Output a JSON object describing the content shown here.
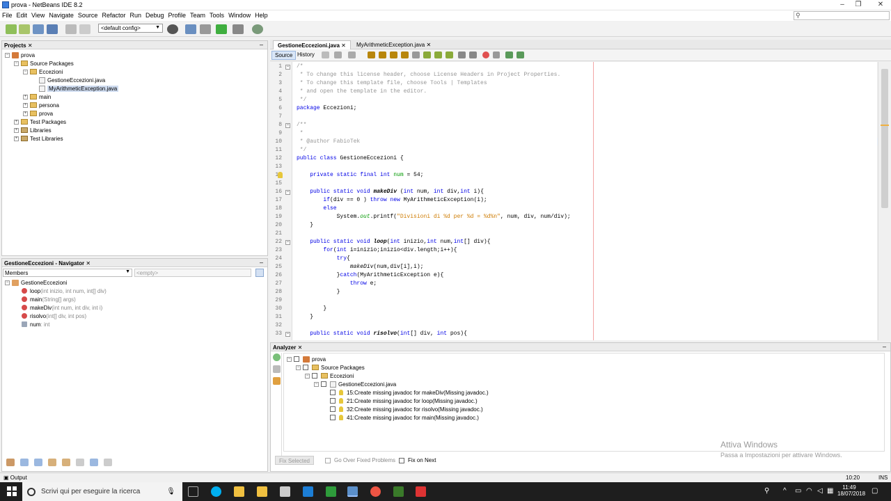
{
  "window": {
    "title": "prova - NetBeans IDE 8.2"
  },
  "menu": [
    "File",
    "Edit",
    "View",
    "Navigate",
    "Source",
    "Refactor",
    "Run",
    "Debug",
    "Profile",
    "Team",
    "Tools",
    "Window",
    "Help"
  ],
  "toolbar": {
    "config": "<default config>"
  },
  "projects": {
    "tab": "Projects",
    "tree": [
      {
        "label": "prova",
        "indent": 0,
        "icon": "project"
      },
      {
        "label": "Source Packages",
        "indent": 1,
        "icon": "folder"
      },
      {
        "label": "Eccezioni",
        "indent": 2,
        "icon": "folder"
      },
      {
        "label": "GestioneEccezioni.java",
        "indent": 3,
        "icon": "java"
      },
      {
        "label": "MyArithmeticException.java",
        "indent": 3,
        "icon": "java",
        "selected": true
      },
      {
        "label": "main",
        "indent": 2,
        "icon": "folder"
      },
      {
        "label": "persona",
        "indent": 2,
        "icon": "folder"
      },
      {
        "label": "prova",
        "indent": 2,
        "icon": "folder"
      },
      {
        "label": "Test Packages",
        "indent": 1,
        "icon": "folder"
      },
      {
        "label": "Libraries",
        "indent": 1,
        "icon": "lib"
      },
      {
        "label": "Test Libraries",
        "indent": 1,
        "icon": "lib"
      }
    ]
  },
  "navigator": {
    "tab": "GestioneEccezioni - Navigator",
    "filter": "Members",
    "empty": "<empty>",
    "root": "GestioneEccezioni",
    "members": [
      {
        "name": "loop",
        "params": "(int inizio, int num, int[] div)"
      },
      {
        "name": "main",
        "params": "(String[] args)"
      },
      {
        "name": "makeDiv",
        "params": "(int num, int div, int i)"
      },
      {
        "name": "risolvo",
        "params": "(int[] div, int pos)"
      },
      {
        "name": "num",
        "params": " : int"
      }
    ]
  },
  "editor": {
    "tabs": [
      "GestioneEccezioni.java",
      "MyArithmeticException.java"
    ],
    "modes": [
      "Source",
      "History"
    ],
    "lines": [
      {
        "n": "1",
        "html": "<span class='cm'>/*</span>"
      },
      {
        "n": "2",
        "html": "<span class='cm'> * To change this license header, choose License Headers in Project Properties.</span>"
      },
      {
        "n": "3",
        "html": "<span class='cm'> * To change this template file, choose Tools | Templates</span>"
      },
      {
        "n": "4",
        "html": "<span class='cm'> * and open the template in the editor.</span>"
      },
      {
        "n": "5",
        "html": "<span class='cm'> */</span>"
      },
      {
        "n": "6",
        "html": "<span class='kw'>package</span> Eccezioni;"
      },
      {
        "n": "7",
        "html": ""
      },
      {
        "n": "8",
        "html": "<span class='cm'>/**</span>"
      },
      {
        "n": "9",
        "html": "<span class='cm'> *</span>"
      },
      {
        "n": "10",
        "html": "<span class='cm'> * @author FabioTek</span>"
      },
      {
        "n": "11",
        "html": "<span class='cm'> */</span>"
      },
      {
        "n": "12",
        "html": "<span class='kw'>public class</span> GestioneEccezioni {"
      },
      {
        "n": "13",
        "html": ""
      },
      {
        "n": "14",
        "html": "    <span class='kw'>private static final int</span> <span style='color:#009900'>num</span> = 54;"
      },
      {
        "n": "15",
        "html": ""
      },
      {
        "n": "16",
        "html": "    <span class='kw'>public static void</span> <span class='fn it'>makeDiv</span> (<span class='kw'>int</span> num, <span class='kw'>int</span> div,<span class='kw'>int</span> i){"
      },
      {
        "n": "17",
        "html": "        <span class='kw'>if</span>(div == 0 ) <span class='kw'>throw new</span> MyArithmeticException(i);"
      },
      {
        "n": "18",
        "html": "        <span class='kw'>else</span>"
      },
      {
        "n": "19",
        "html": "            System.<span class='it' style='color:#009900'>out</span>.printf(<span class='str'>\"Divisioni di %d per %d = %d%n\"</span>, num, div, num/div);"
      },
      {
        "n": "20",
        "html": "    }"
      },
      {
        "n": "21",
        "html": ""
      },
      {
        "n": "22",
        "html": "    <span class='kw'>public static void</span> <span class='fn it'>loop</span>(<span class='kw'>int</span> inizio,<span class='kw'>int</span> num,<span class='kw'>int</span>[] div){"
      },
      {
        "n": "23",
        "html": "        <span class='kw'>for</span>(<span class='kw'>int</span> i=inizio;inizio&lt;div.length;i++){"
      },
      {
        "n": "24",
        "html": "            <span class='kw'>try</span>{"
      },
      {
        "n": "25",
        "html": "                <span class='it'>makeDiv</span>(num,div[i],i);"
      },
      {
        "n": "26",
        "html": "            }<span class='kw'>catch</span>(MyArithmeticException e){"
      },
      {
        "n": "27",
        "html": "                <span class='kw'>throw</span> e;"
      },
      {
        "n": "28",
        "html": "            }"
      },
      {
        "n": "29",
        "html": ""
      },
      {
        "n": "30",
        "html": "        }"
      },
      {
        "n": "31",
        "html": "    }"
      },
      {
        "n": "32",
        "html": ""
      },
      {
        "n": "33",
        "html": "    <span class='kw'>public static void</span> <span class='fn it'>risolvo</span>(<span class='kw'>int</span>[] div, <span class='kw'>int</span> pos){"
      }
    ]
  },
  "analyzer": {
    "tab": "Analyzer",
    "tree": [
      {
        "label": "prova",
        "indent": 0,
        "icon": "project"
      },
      {
        "label": "Source Packages",
        "indent": 1,
        "icon": "folder"
      },
      {
        "label": "Eccezioni",
        "indent": 2,
        "icon": "folder"
      },
      {
        "label": "GestioneEccezioni.java",
        "indent": 3,
        "icon": "java"
      },
      {
        "label": "15:Create missing javadoc for makeDiv(Missing javadoc.)",
        "indent": 4,
        "icon": "hint"
      },
      {
        "label": "21:Create missing javadoc for loop(Missing javadoc.)",
        "indent": 4,
        "icon": "hint"
      },
      {
        "label": "32:Create missing javadoc for risolvo(Missing javadoc.)",
        "indent": 4,
        "icon": "hint"
      },
      {
        "label": "41:Create missing javadoc for main(Missing javadoc.)",
        "indent": 4,
        "icon": "hint"
      }
    ],
    "fix_selected": "Fix Selected",
    "go_over": "Go Over Fixed Problems",
    "fix_next": "Fix on Next"
  },
  "watermark": {
    "title": "Attiva Windows",
    "subtitle": "Passa a Impostazioni per attivare Windows."
  },
  "status": {
    "output": "Output",
    "position": "10:20",
    "mode": "INS"
  },
  "taskbar": {
    "search": "Scrivi qui per eseguire la ricerca",
    "time": "11:49",
    "date": "18/07/2018"
  }
}
